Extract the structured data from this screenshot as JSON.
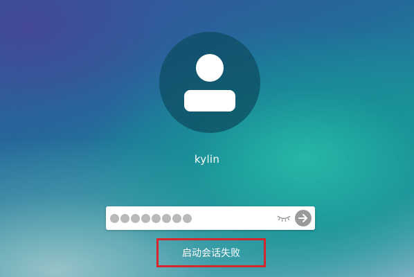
{
  "login": {
    "username": "kylin",
    "password_masked_count": 8,
    "error_message": "启动会话失败"
  },
  "icons": {
    "avatar": "user-avatar-icon",
    "eye": "eye-closed-icon",
    "submit": "arrow-right-icon"
  },
  "colors": {
    "error_highlight": "#d6252b",
    "dot": "#b9b9b9",
    "submit_button": "#9a9a9a",
    "avatar_circle": "#0c4b5f"
  }
}
